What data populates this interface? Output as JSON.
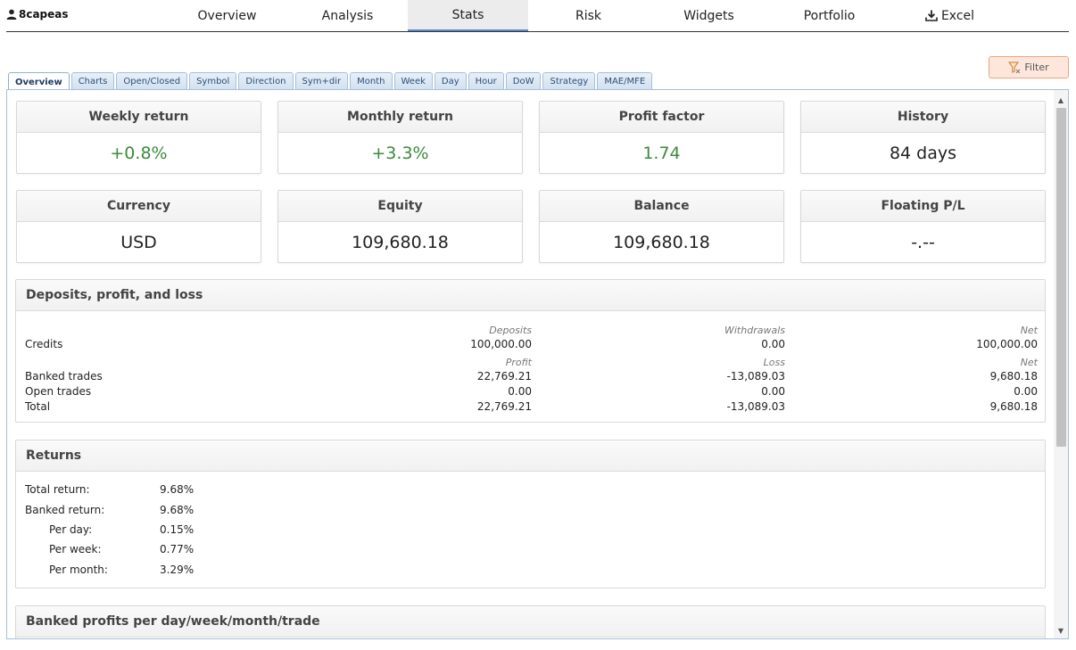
{
  "account": {
    "name": "8capeas"
  },
  "nav": {
    "items": [
      {
        "label": "Overview"
      },
      {
        "label": "Analysis"
      },
      {
        "label": "Stats"
      },
      {
        "label": "Risk"
      },
      {
        "label": "Widgets"
      },
      {
        "label": "Portfolio"
      },
      {
        "label": "Excel"
      }
    ],
    "active": "Stats"
  },
  "filter": {
    "label": "Filter"
  },
  "tabs": [
    "Overview",
    "Charts",
    "Open/Closed",
    "Symbol",
    "Direction",
    "Sym+dir",
    "Month",
    "Week",
    "Day",
    "Hour",
    "DoW",
    "Strategy",
    "MAE/MFE"
  ],
  "active_tab": "Overview",
  "cards": [
    {
      "title": "Weekly return",
      "value": "+0.8%"
    },
    {
      "title": "Monthly return",
      "value": "+3.3%"
    },
    {
      "title": "Profit factor",
      "value": "1.74"
    },
    {
      "title": "History",
      "value": "84 days"
    },
    {
      "title": "Currency",
      "value": "USD"
    },
    {
      "title": "Equity",
      "value": "109,680.18"
    },
    {
      "title": "Balance",
      "value": "109,680.18"
    },
    {
      "title": "Floating P/L",
      "value": "-.--"
    }
  ],
  "deposits": {
    "title": "Deposits, profit, and loss",
    "cap1": {
      "deposits": "Deposits",
      "withdrawals": "Withdrawals",
      "net": "Net"
    },
    "credits": {
      "label": "Credits",
      "deposits": "100,000.00",
      "withdrawals": "0.00",
      "net": "100,000.00"
    },
    "cap2": {
      "profit": "Profit",
      "loss": "Loss",
      "net": "Net"
    },
    "rows": [
      {
        "label": "Banked trades",
        "profit": "22,769.21",
        "loss": "-13,089.03",
        "net": "9,680.18"
      },
      {
        "label": "Open trades",
        "profit": "0.00",
        "loss": "0.00",
        "net": "0.00"
      },
      {
        "label": "Total",
        "profit": "22,769.21",
        "loss": "-13,089.03",
        "net": "9,680.18"
      }
    ]
  },
  "returns": {
    "title": "Returns",
    "rows": [
      {
        "label": "Total return:",
        "value": "9.68%"
      },
      {
        "label": "Banked return:",
        "value": "9.68%"
      },
      {
        "label": "Per day:",
        "value": "0.15%"
      },
      {
        "label": "Per week:",
        "value": "0.77%"
      },
      {
        "label": "Per month:",
        "value": "3.29%"
      }
    ]
  },
  "banked": {
    "title": "Banked profits per day/week/month/trade"
  },
  "colors": {
    "positive": "#3c8a3c",
    "tab_border": "#a6c0dc",
    "filter_bg": "#fde7dd"
  }
}
